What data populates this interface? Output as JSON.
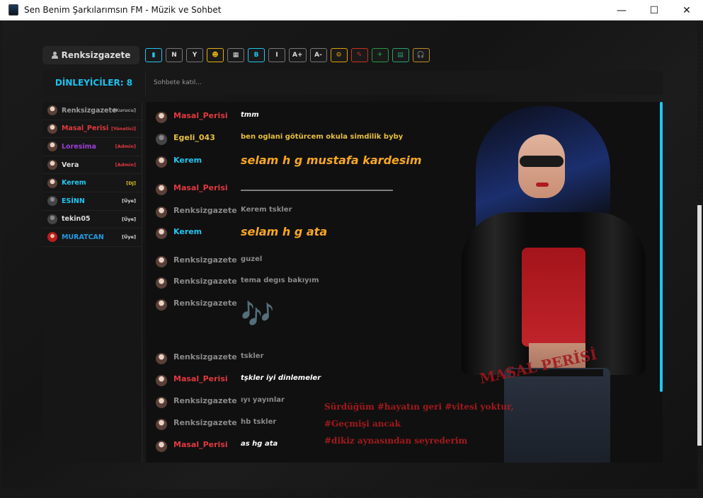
{
  "window": {
    "title": "Sen Benim Şarkılarımsın FM - Müzik ve Sohbet",
    "controls": {
      "minimize": "—",
      "maximize": "☐",
      "close": "✕"
    }
  },
  "header": {
    "current_user": "Renksizgazete",
    "toolbar": [
      "▮",
      "N",
      "Y",
      "☻",
      "▦",
      "B",
      "I",
      "A+",
      "A-",
      "⚙",
      "✎",
      "✈",
      "▤",
      "🎧"
    ],
    "toolbar_colors": [
      "#1ec6f2",
      "#777",
      "#777",
      "#e0b010",
      "#777",
      "#1ec6f2",
      "#777",
      "#777",
      "#777",
      "#e0a000",
      "#d03020",
      "#2a9a40",
      "#2aa070",
      "#c08a20"
    ]
  },
  "listeners": {
    "label": "DİNLEYİCİLER: 8"
  },
  "chat_input": {
    "placeholder": "Sohbete katıl..."
  },
  "users": [
    {
      "name": "Renksizgazete",
      "role": "[Kurucu]",
      "color": "#9a9a9a",
      "role_color": "#9a9a9a",
      "avatar": "photo"
    },
    {
      "name": "Masal_Perisi",
      "role": "[Yönetici]",
      "color": "#e0393f",
      "role_color": "#e0393f",
      "avatar": "photo"
    },
    {
      "name": "Loresima",
      "role": "[Admin]",
      "color": "#9b3fd4",
      "role_color": "#e0393f",
      "avatar": "photo"
    },
    {
      "name": "Vera",
      "role": "[Admin]",
      "color": "#dddddd",
      "role_color": "#e0393f",
      "avatar": "photo"
    },
    {
      "name": "Kerem",
      "role": "[DJ]",
      "color": "#1ec6f2",
      "role_color": "#e0c020",
      "avatar": "photo"
    },
    {
      "name": "ESİNN",
      "role": "[Üye]",
      "color": "#1ec6f2",
      "role_color": "#dddddd",
      "avatar": "gray"
    },
    {
      "name": "tekin05",
      "role": "[Üye]",
      "color": "#dddddd",
      "role_color": "#dddddd",
      "avatar": "gray"
    },
    {
      "name": "MURATCAN",
      "role": "[Üye]",
      "color": "#1e9ae0",
      "role_color": "#dddddd",
      "avatar": "red"
    }
  ],
  "messages": [
    {
      "user": "Masal_Perisi",
      "text": "tmm",
      "user_color": "#e0393f",
      "text_color": "#ffffff",
      "style": "it"
    },
    {
      "user": "Egeli_043",
      "text": "ben oglani götürcem okula simdilik byby",
      "user_color": "#e8c040",
      "text_color": "#e8c040",
      "style": ""
    },
    {
      "user": "Kerem",
      "text": "selam h g mustafa kardesim",
      "user_color": "#1ec6f2",
      "text_color": "#f5a623",
      "style": "big"
    },
    {
      "user": "Masal_Perisi",
      "text": "___________________________________________",
      "user_color": "#e0393f",
      "text_color": "#ffffff",
      "style": "line"
    },
    {
      "user": "Renksizgazete",
      "text": "Kerem tskler",
      "user_color": "#8a8a8a",
      "text_color": "#8a8a8a",
      "style": ""
    },
    {
      "user": "Kerem",
      "text": "selam h g ata",
      "user_color": "#1ec6f2",
      "text_color": "#f5a623",
      "style": "big"
    },
    {
      "user": "Renksizgazete",
      "text": "guzel",
      "user_color": "#8a8a8a",
      "text_color": "#8a8a8a",
      "style": ""
    },
    {
      "user": "Renksizgazete",
      "text": "tema degıs bakıyım",
      "user_color": "#8a8a8a",
      "text_color": "#8a8a8a",
      "style": ""
    },
    {
      "user": "Renksizgazete",
      "text": "🎶",
      "user_color": "#8a8a8a",
      "text_color": "#8a9aaa",
      "style": "notes"
    },
    {
      "user": "Renksizgazete",
      "text": "tskler",
      "user_color": "#8a8a8a",
      "text_color": "#8a8a8a",
      "style": ""
    },
    {
      "user": "Masal_Perisi",
      "text": "tşkler iyi dinlemeler",
      "user_color": "#e0393f",
      "text_color": "#ffffff",
      "style": "it"
    },
    {
      "user": "Renksizgazete",
      "text": "ıyı yayınlar",
      "user_color": "#8a8a8a",
      "text_color": "#8a8a8a",
      "style": ""
    },
    {
      "user": "Renksizgazete",
      "text": "hb tskler",
      "user_color": "#8a8a8a",
      "text_color": "#8a8a8a",
      "style": ""
    },
    {
      "user": "Masal_Perisi",
      "text": "as hg ata",
      "user_color": "#e0393f",
      "text_color": "#ffffff",
      "style": "it"
    }
  ],
  "background": {
    "stamp": "MASAL PERİSİ",
    "quote_lines": [
      "Sürdüğüm #hayatın geri #vitesi yoktur,",
      "#Geçmişi ancak",
      "#dikiz aynasından seyrederim"
    ]
  },
  "colors": {
    "accent": "#1ec6f2",
    "panel": "#181818",
    "danger": "#e0393f"
  }
}
